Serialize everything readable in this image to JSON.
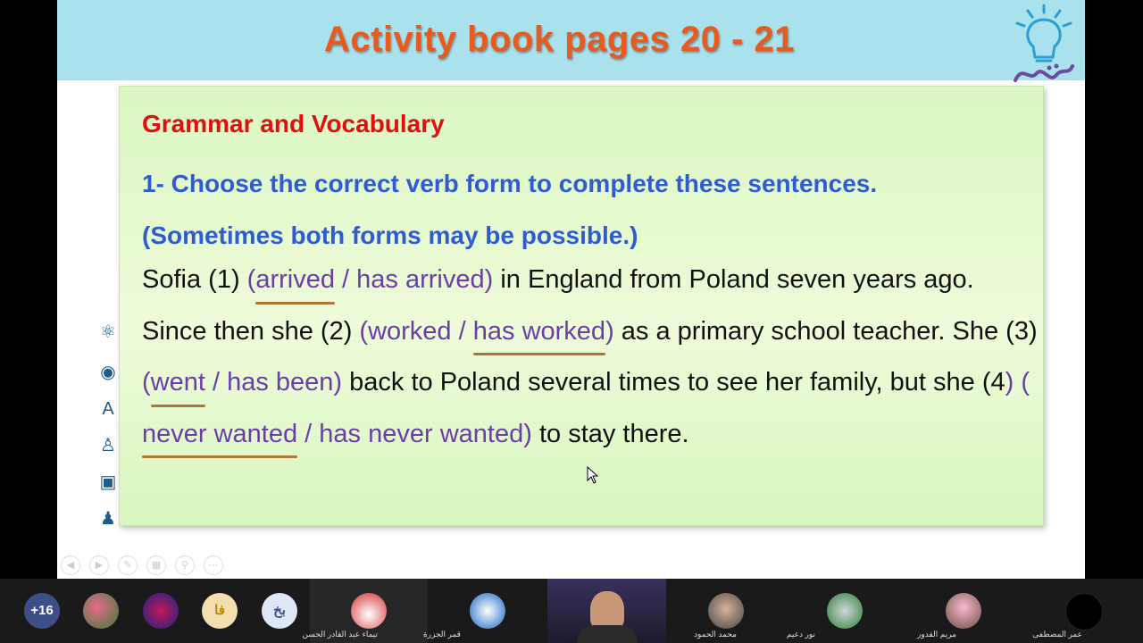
{
  "slide": {
    "title": "Activity book pages 20 - 21",
    "heading": "Grammar and Vocabulary",
    "instruction_line1": "1- Choose the correct verb form to complete these sentences.",
    "instruction_line2": "(Sometimes both forms may be possible.)",
    "passage": {
      "p1": "Sofia (1) ",
      "o1_open": "(",
      "o1_choice": "arrived",
      "o1_rest": " / has arrived)",
      "p2": " in England from Poland seven years ago. Since then she (2) ",
      "o2_a": "(worked / ",
      "o2_choice": "has worked",
      "o2_close": ")",
      "p3": " as a primary school teacher. She (3) ",
      "o3_open": "(",
      "o3_choice": "went",
      "o3_rest": " / has been)",
      "p4": " back to Poland several times to see her family, but she (4",
      "o4_open": ") (",
      "o4_choice": "never wanted",
      "o4_rest": " / has never wanted)",
      "p5": " to stay there."
    },
    "colors": {
      "title": "#e85a1e",
      "title_bar": "#a9e1ec",
      "heading": "#e01010",
      "instruction": "#2f5bd3",
      "options": "#6a3ea8",
      "underline": "#b07434",
      "card": "#e4f8cf"
    },
    "logo_icon": "lightbulb-logo-icon",
    "side_icons": [
      "atom-icon",
      "brain-icon",
      "letters-icon",
      "teacher-icon",
      "monitor-user-icon",
      "person-icon"
    ]
  },
  "participants": {
    "overflow_count": "+16",
    "initials": [
      "فا",
      "بخ"
    ],
    "named": [
      "تيماء عبد القادر الحسن",
      "قمر الجزرة",
      "محمد الحمود",
      "نور دعيم",
      "مريم القدور",
      "عمر المصطفى"
    ]
  }
}
